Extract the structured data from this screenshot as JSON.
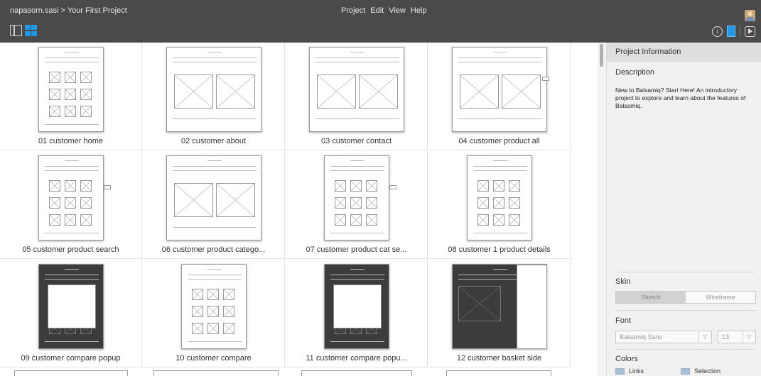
{
  "topbar": {
    "breadcrumb": "napasorn.sasi > Your First Project",
    "menu": [
      "Project",
      "Edit",
      "View",
      "Help"
    ]
  },
  "mockups": [
    {
      "label": "01 customer home",
      "style": "tall"
    },
    {
      "label": "02 customer about",
      "style": "wide"
    },
    {
      "label": "03 customer contact",
      "style": "wide"
    },
    {
      "label": "04 customer product all",
      "style": "wide"
    },
    {
      "label": "05 customer product search",
      "style": "tall"
    },
    {
      "label": "06 customer product catego...",
      "style": "wide"
    },
    {
      "label": "07 customer product cat se...",
      "style": "tall"
    },
    {
      "label": "08 customer 1 product details",
      "style": "tall"
    },
    {
      "label": "09 customer compare popup",
      "style": "dark"
    },
    {
      "label": "10 customer compare",
      "style": "tall"
    },
    {
      "label": "11 customer compare popu...",
      "style": "dark"
    },
    {
      "label": "12 customer basket side",
      "style": "darkwide"
    }
  ],
  "panel": {
    "header": "Project Information",
    "description_title": "Description",
    "description_text": "New to Balsamiq? Start Here! An introductory project to explore and learn about the features of Balsamiq.",
    "skin_title": "Skin",
    "skin_options": [
      "Sketch",
      "Wireframe"
    ],
    "skin_selected": "Sketch",
    "font_title": "Font",
    "font_family": "Balsamiq Sans",
    "font_size": "13",
    "colors_title": "Colors",
    "color_links_label": "Links",
    "color_selection_label": "Selection",
    "colors": {
      "links": "#a9bfd5",
      "selection": "#b9cde0"
    }
  },
  "icons": [
    "list-view-icon",
    "grid-view-icon",
    "info-icon",
    "panel-toggle-icon",
    "play-icon",
    "avatar",
    "dropdown-arrow-icon"
  ]
}
